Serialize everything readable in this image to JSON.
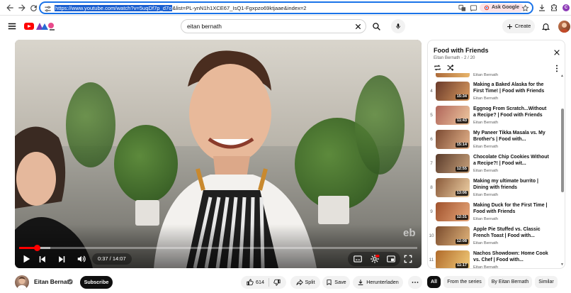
{
  "browser": {
    "url_selected": "https://www.youtube.com/watch?v=5uqDf7p_d7o",
    "url_rest": "&list=PL-ynN1h1XCE67_IsQ1-Fgxpzo69ktjaae&index=2",
    "ask_label": "Ask Google",
    "profile_initial": "C"
  },
  "header": {
    "search_query": "eitan bernath",
    "create_label": "Create"
  },
  "player": {
    "time_current": "0:37",
    "time_total": "14:07",
    "time_display": "0:37 / 14:07",
    "progress_fraction": 0.044,
    "buffered_fraction": 0.078,
    "watermark": "eb"
  },
  "channel": {
    "name": "Eitan Bernath",
    "subscribe_label": "Subscribe"
  },
  "actions": {
    "like_count": "614",
    "split_label": "Split",
    "save_label": "Save",
    "download_label": "Herunterladen"
  },
  "playlist": {
    "title": "Food with Friends",
    "subtitle": "Eitan Bernath - 2 / 20",
    "peek_channel": "Eitan Bernath",
    "items": [
      {
        "index": "4",
        "title": "Making a Baked Alaska for the First Time! | Food with Friends",
        "channel": "Eitan Bernath",
        "duration": "15:34",
        "thumb_a": "#6a3a2a",
        "thumb_b": "#d99a5f"
      },
      {
        "index": "5",
        "title": "Eggnog From Scratch...Without a Recipe? | Food with Friends",
        "channel": "Eitan Bernath",
        "duration": "11:43",
        "thumb_a": "#b0655a",
        "thumb_b": "#efc9a0"
      },
      {
        "index": "6",
        "title": "My Paneer Tikka Masala vs. My Brother's | Food with...",
        "channel": "Eitan Bernath",
        "duration": "15:14",
        "thumb_a": "#7b4a32",
        "thumb_b": "#e6b48c"
      },
      {
        "index": "7",
        "title": "Chocolate Chip Cookies Without a Recipe?! | Food wit...",
        "channel": "Eitan Bernath",
        "duration": "12:55",
        "thumb_a": "#5a3b2b",
        "thumb_b": "#c9a27b"
      },
      {
        "index": "8",
        "title": "Making my ultimate burrito | Dining with friends",
        "channel": "Eitan Bernath",
        "duration": "13:06",
        "thumb_a": "#8a5a3a",
        "thumb_b": "#f0d2a6"
      },
      {
        "index": "9",
        "title": "Making Duck for the First Time | Food with Friends",
        "channel": "Eitan Bernath",
        "duration": "12:31",
        "thumb_a": "#a0522d",
        "thumb_b": "#e7a77a"
      },
      {
        "index": "10",
        "title": "Apple Pie Stuffed vs. Classic French Toast | Food with...",
        "channel": "Eitan Bernath",
        "duration": "12:08",
        "thumb_a": "#7a4b2d",
        "thumb_b": "#e3b67c"
      },
      {
        "index": "11",
        "title": "Nachos Showdown: Home Cook vs. Chef | Food with...",
        "channel": "Eitan Bernath",
        "duration": "11:17",
        "thumb_a": "#b06a2a",
        "thumb_b": "#f3cd7a"
      }
    ]
  },
  "chips": [
    "All",
    "From the series",
    "By Eitan Bernath",
    "Similar"
  ],
  "colors": {
    "accent_red": "#ff0000",
    "omnibox_border": "#1a73e8",
    "chip_active": "#0f0f0f"
  }
}
